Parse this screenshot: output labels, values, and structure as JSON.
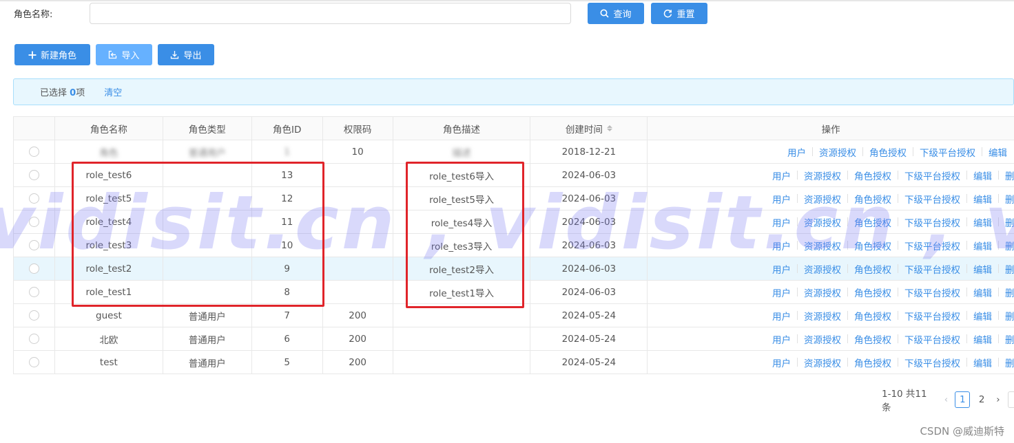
{
  "search": {
    "label": "角色名称:",
    "placeholder": "",
    "value": "",
    "query_label": "查询",
    "reset_label": "重置"
  },
  "toolbar": {
    "new_label": "新建角色",
    "import_label": "导入",
    "export_label": "导出"
  },
  "selection": {
    "prefix": "已选择",
    "count": "0",
    "suffix": "项",
    "clear_label": "清空"
  },
  "table": {
    "headers": [
      "角色名称",
      "角色类型",
      "角色ID",
      "权限码",
      "角色描述",
      "创建时间",
      "操作"
    ],
    "rows": [
      {
        "name": "角色",
        "type": "普通用户",
        "id": "1",
        "code": "10",
        "desc": "描述",
        "created": "2018-12-21",
        "blurred": true
      },
      {
        "name": "role_test6",
        "type": "",
        "id": "13",
        "code": "",
        "desc": "role_test6导入",
        "created": "2024-06-03"
      },
      {
        "name": "role_test5",
        "type": "",
        "id": "12",
        "code": "",
        "desc": "role_test5导入",
        "created": "2024-06-03"
      },
      {
        "name": "role_test4",
        "type": "",
        "id": "11",
        "code": "",
        "desc": "role_tes4导入",
        "created": "2024-06-03"
      },
      {
        "name": "role_test3",
        "type": "",
        "id": "10",
        "code": "",
        "desc": "role_tes3导入",
        "created": "2024-06-03"
      },
      {
        "name": "role_test2",
        "type": "",
        "id": "9",
        "code": "",
        "desc": "role_test2导入",
        "created": "2024-06-03"
      },
      {
        "name": "role_test1",
        "type": "",
        "id": "8",
        "code": "",
        "desc": "role_test1导入",
        "created": "2024-06-03"
      },
      {
        "name": "guest",
        "type": "普通用户",
        "id": "7",
        "code": "200",
        "desc": "",
        "created": "2024-05-24"
      },
      {
        "name": "北欧",
        "type": "普通用户",
        "id": "6",
        "code": "200",
        "desc": "",
        "created": "2024-05-24"
      },
      {
        "name": "test",
        "type": "普通用户",
        "id": "5",
        "code": "200",
        "desc": "",
        "created": "2024-05-24"
      }
    ],
    "actions": [
      "用户",
      "资源授权",
      "角色授权",
      "下级平台授权",
      "编辑",
      "删除"
    ]
  },
  "pagination": {
    "total_text": "1-10 共11条",
    "pages": [
      "1",
      "2"
    ],
    "current": "1",
    "prev": "‹",
    "next": "›"
  },
  "watermark": "vidisit.cn , vidisit.cn , vidisit.cn",
  "credit": "CSDN @威迪斯特",
  "colors": {
    "primary": "#3a8ee6",
    "primary_light": "#66b1ff",
    "annotation_red": "#e0242a",
    "watermark": "#7878f0"
  }
}
